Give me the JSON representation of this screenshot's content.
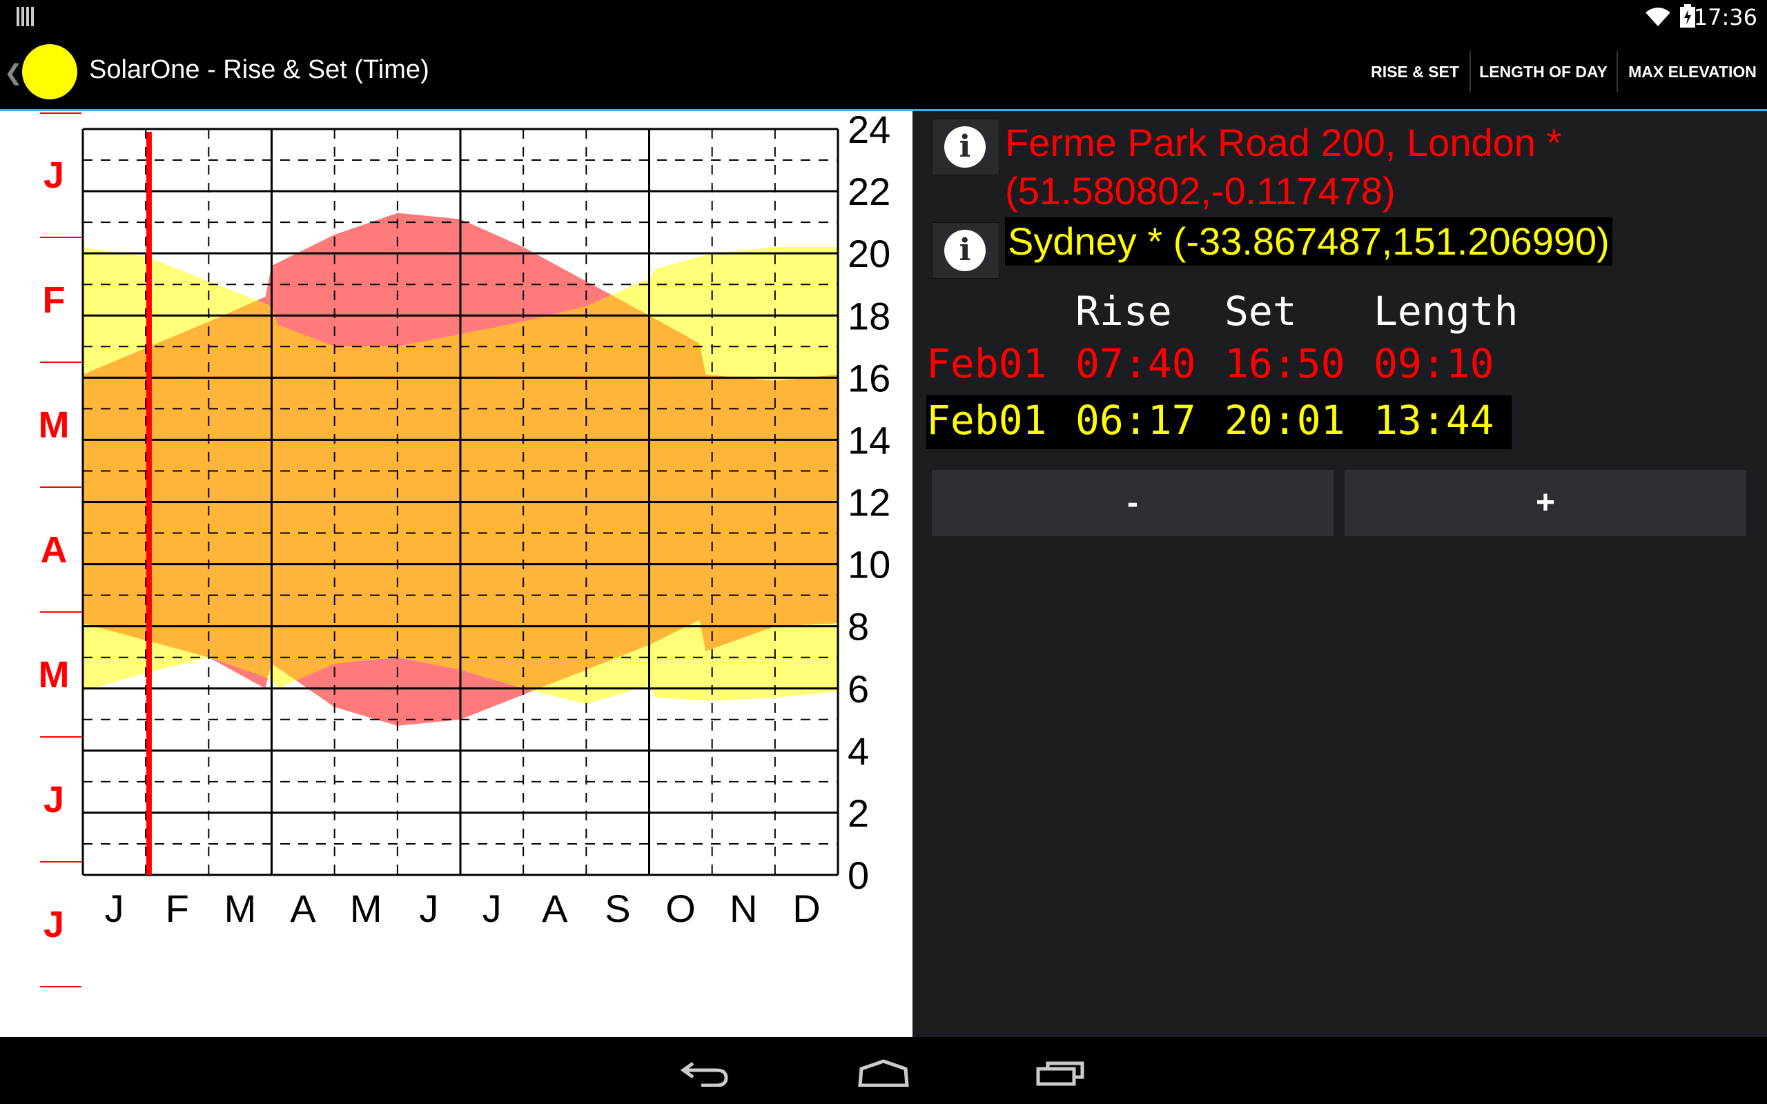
{
  "status_bar": {
    "time": "17:36"
  },
  "app_bar": {
    "title": "SolarOne - Rise & Set (Time)",
    "tabs": [
      "RISE & SET",
      "LENGTH OF DAY",
      "MAX ELEVATION"
    ]
  },
  "colors": {
    "london": "#ff0000",
    "sydney": "#ffff00",
    "accent": "#33b5e5"
  },
  "locations": [
    {
      "name": "Ferme Park Road 200, London *",
      "coords": "(51.580802,-0.117478)"
    },
    {
      "name": "Sydney * (-33.867487,151.206990)"
    }
  ],
  "table": {
    "headers": {
      "rise": "Rise",
      "set": "Set",
      "length": "Length"
    },
    "rows": [
      {
        "date": "Feb01",
        "rise": "07:40",
        "set": "16:50",
        "length": "09:10"
      },
      {
        "date": "Feb01",
        "rise": "06:17",
        "set": "20:01",
        "length": "13:44"
      }
    ]
  },
  "buttons": {
    "minus": "-",
    "plus": "+"
  },
  "side_months": [
    "J",
    "F",
    "M",
    "A",
    "M",
    "J",
    "J"
  ],
  "chart_data": {
    "type": "area",
    "xlabels": [
      "J",
      "F",
      "M",
      "A",
      "M",
      "J",
      "J",
      "A",
      "S",
      "O",
      "N",
      "D"
    ],
    "ylabels": [
      "0",
      "2",
      "4",
      "6",
      "8",
      "10",
      "12",
      "14",
      "16",
      "18",
      "20",
      "22",
      "24"
    ],
    "ylim": [
      0,
      24
    ],
    "current_day": 32,
    "series": [
      {
        "name": "Ferme Park Road 200, London *",
        "sunrise": [
          [
            0,
            8.1
          ],
          [
            2,
            7.0
          ],
          [
            2.9,
            6.0
          ],
          [
            3.0,
            6.8
          ],
          [
            4,
            5.4
          ],
          [
            5,
            4.8
          ],
          [
            6,
            5.0
          ],
          [
            7,
            5.8
          ],
          [
            8,
            6.6
          ],
          [
            9,
            7.4
          ],
          [
            9.8,
            8.2
          ],
          [
            9.9,
            7.2
          ],
          [
            11,
            8.0
          ],
          [
            12,
            8.1
          ]
        ],
        "sunset": [
          [
            0,
            16.1
          ],
          [
            2,
            17.8
          ],
          [
            2.9,
            18.6
          ],
          [
            3.0,
            19.6
          ],
          [
            4,
            20.6
          ],
          [
            5,
            21.3
          ],
          [
            6,
            21.1
          ],
          [
            7,
            20.2
          ],
          [
            8,
            19.1
          ],
          [
            9,
            18.0
          ],
          [
            9.8,
            17.1
          ],
          [
            9.9,
            16.1
          ],
          [
            11,
            15.9
          ],
          [
            12,
            16.1
          ]
        ]
      },
      {
        "name": "Sydney *",
        "sunrise": [
          [
            0,
            5.9
          ],
          [
            1,
            6.5
          ],
          [
            2,
            7.0
          ],
          [
            3,
            6.3
          ],
          [
            3.1,
            6.0
          ],
          [
            4,
            6.8
          ],
          [
            5,
            7.0
          ],
          [
            6,
            6.6
          ],
          [
            7,
            6.0
          ],
          [
            8,
            5.5
          ],
          [
            9,
            6.1
          ],
          [
            9.1,
            5.7
          ],
          [
            10,
            5.6
          ],
          [
            11,
            5.7
          ],
          [
            12,
            5.9
          ]
        ],
        "sunset": [
          [
            0,
            20.2
          ],
          [
            1,
            19.9
          ],
          [
            2,
            19.1
          ],
          [
            3,
            18.3
          ],
          [
            3.1,
            17.7
          ],
          [
            4,
            17.0
          ],
          [
            5,
            17.0
          ],
          [
            6,
            17.4
          ],
          [
            7,
            17.8
          ],
          [
            8,
            18.3
          ],
          [
            9,
            19.2
          ],
          [
            9.1,
            19.5
          ],
          [
            10,
            20.0
          ],
          [
            11,
            20.2
          ],
          [
            12,
            20.2
          ]
        ]
      }
    ]
  }
}
